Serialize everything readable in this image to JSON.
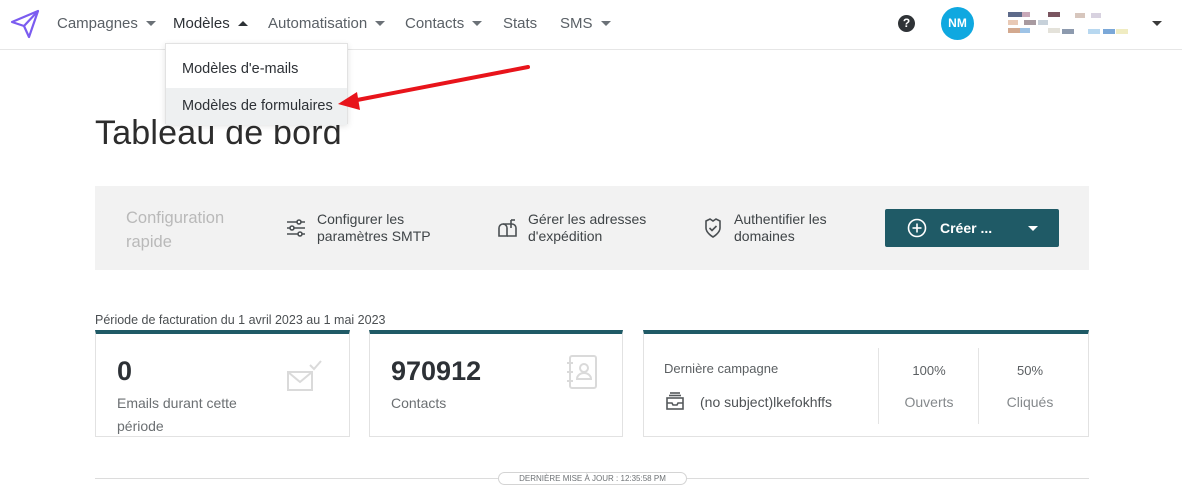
{
  "nav": {
    "items": [
      {
        "label": "Campagnes"
      },
      {
        "label": "Modèles"
      },
      {
        "label": "Automatisation"
      },
      {
        "label": "Contacts"
      },
      {
        "label": "Stats"
      },
      {
        "label": "SMS"
      }
    ],
    "help": "?",
    "avatar_initials": "NM"
  },
  "dropdown": {
    "items": [
      {
        "label": "Modèles d'e-mails"
      },
      {
        "label": "Modèles de formulaires"
      }
    ]
  },
  "page": {
    "title": "Tableau de bord"
  },
  "quick_setup": {
    "label": "Configuration\nrapide",
    "actions": [
      {
        "label": "Configurer les\nparamètres SMTP",
        "icon": "sliders-icon"
      },
      {
        "label": "Gérer les adresses\nd'expédition",
        "icon": "mailbox-icon"
      },
      {
        "label": "Authentifier les\ndomaines",
        "icon": "shield-check-icon"
      }
    ],
    "create_label": "Créer ..."
  },
  "billing": {
    "period": "Période de facturation du 1 avril 2023 au 1 mai 2023"
  },
  "cards": {
    "emails": {
      "value": "0",
      "label": "Emails durant cette\npériode"
    },
    "contacts": {
      "value": "970912",
      "label": "Contacts"
    },
    "last_campaign": {
      "label": "Dernière campagne",
      "subject": "(no subject)lkefokhffs",
      "opened_value": "100%",
      "opened_label": "Ouverts",
      "clicked_value": "50%",
      "clicked_label": "Cliqués"
    }
  },
  "footer": {
    "last_update": "DERNIÈRE MISE À JOUR : 12:35:58 PM"
  },
  "colors": {
    "accent": "#1f5a66",
    "avatar": "#0fa8e0",
    "annotation_arrow": "#e8141b",
    "logo": "#7b5cf0"
  }
}
